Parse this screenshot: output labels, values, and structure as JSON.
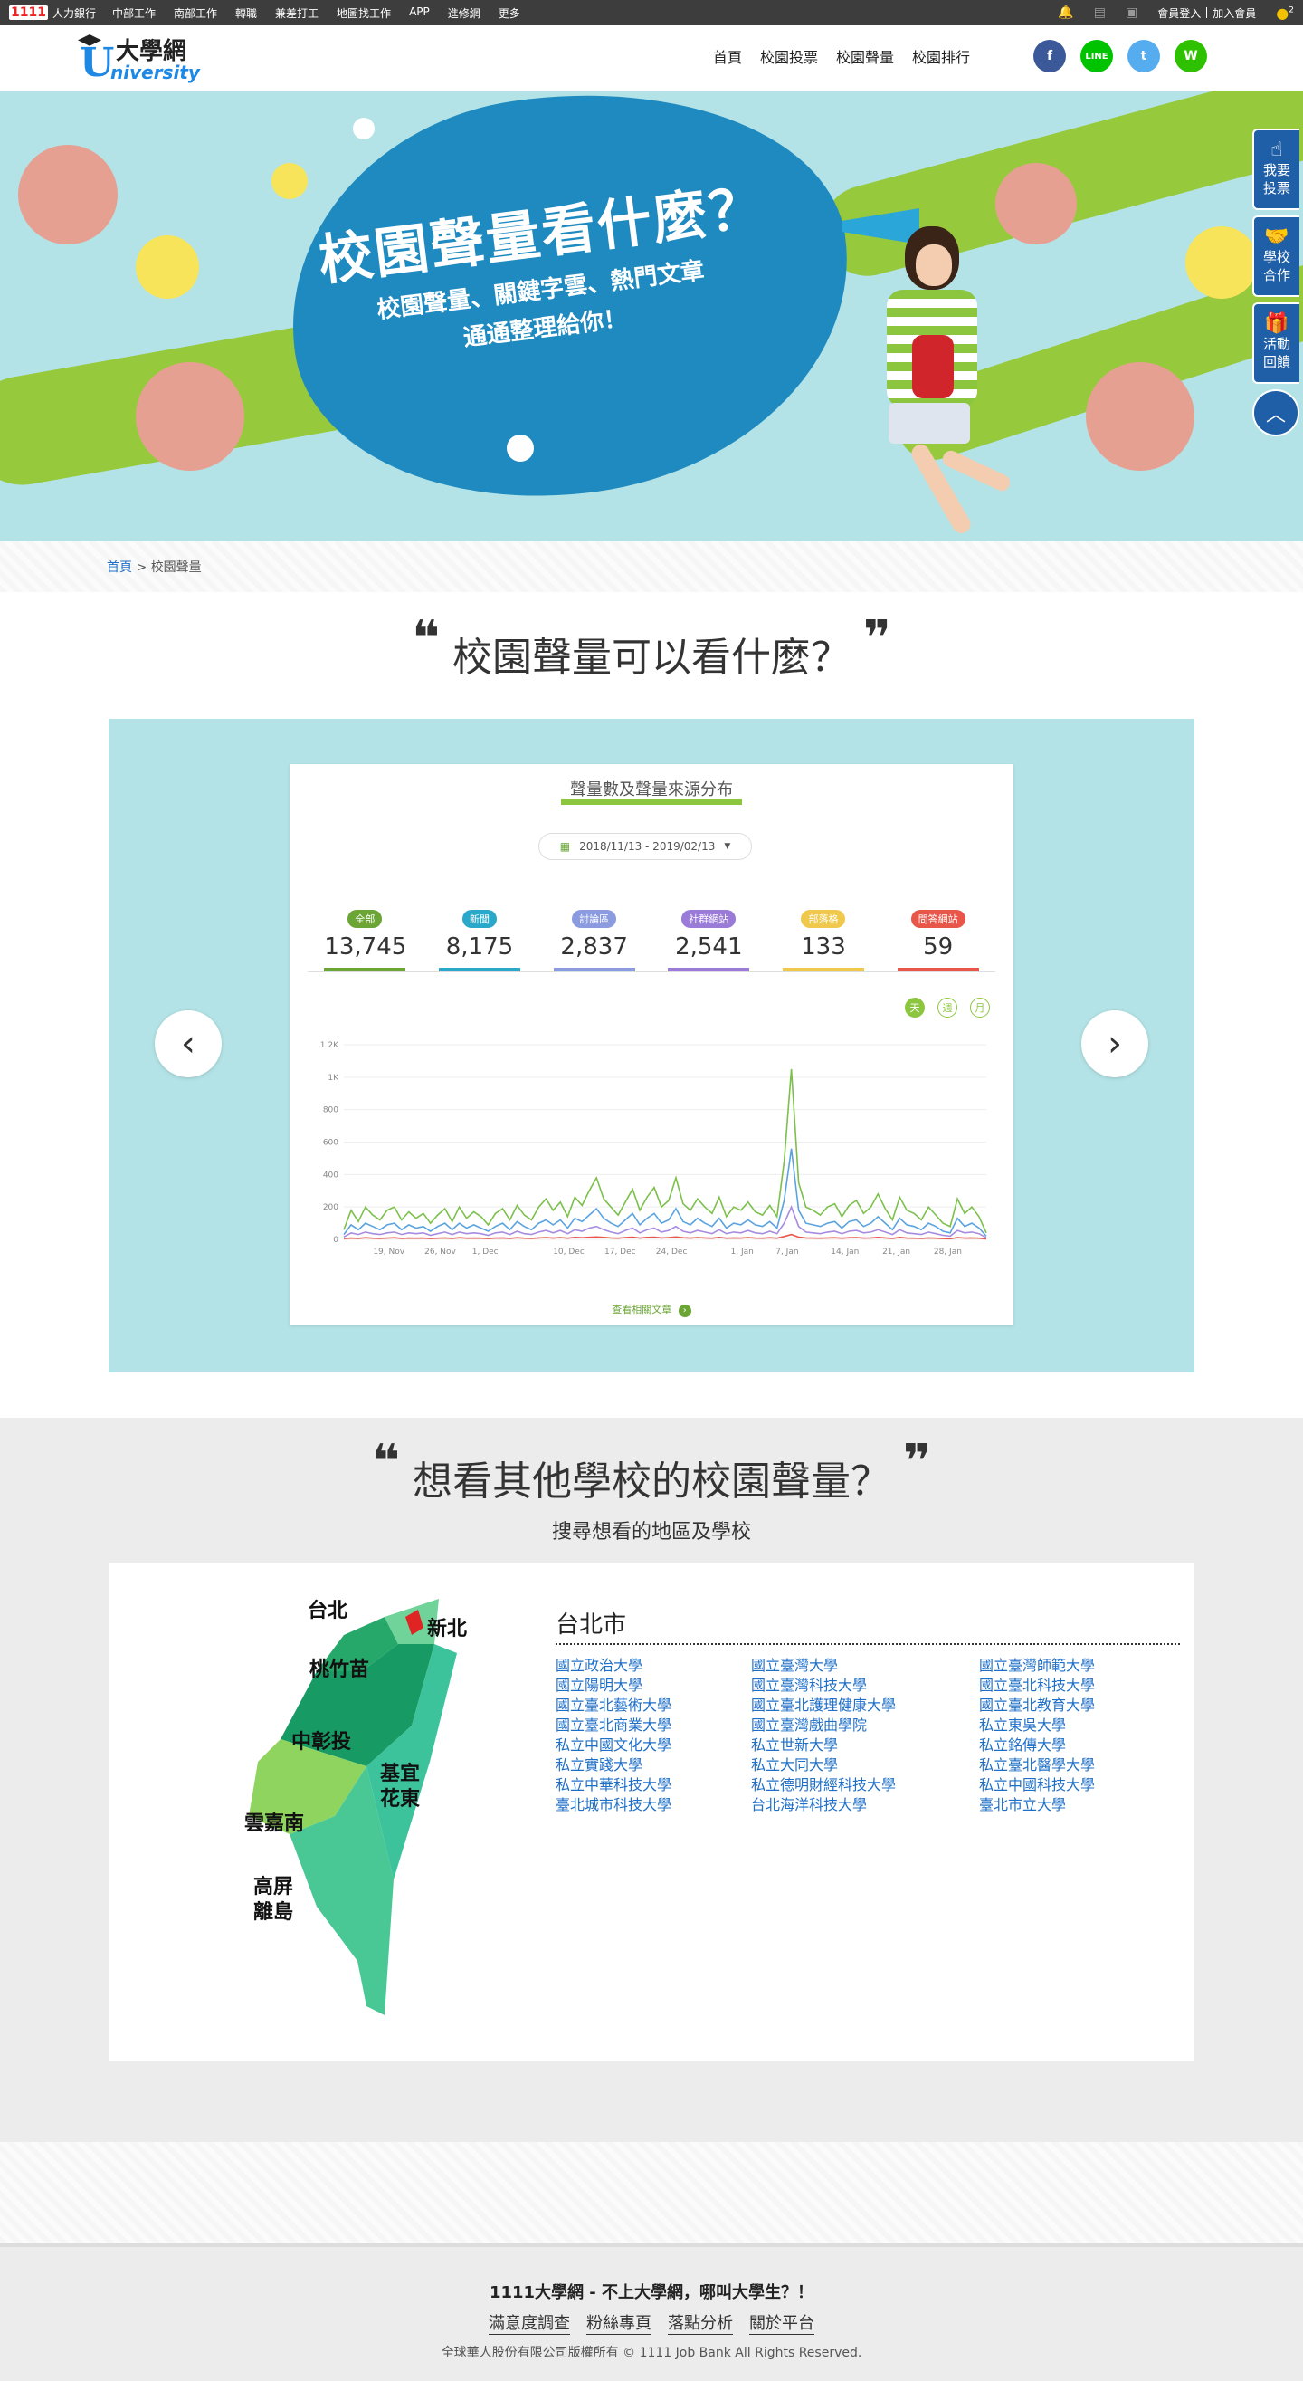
{
  "topbar": {
    "brand_num": "1111",
    "brand": "人力銀行",
    "links": [
      "中部工作",
      "南部工作",
      "轉職",
      "兼差打工",
      "地圖找工作",
      "APP",
      "進修網",
      "更多"
    ],
    "login": "會員登入",
    "register": "加入會員",
    "notify_count": "2"
  },
  "header": {
    "logo_cn": "大學網",
    "logo_u": "U",
    "logo_en": "niversity",
    "nav": [
      "首頁",
      "校園投票",
      "校園聲量",
      "校園排行"
    ],
    "social": [
      {
        "name": "facebook",
        "label": "f",
        "color": "#3b5998"
      },
      {
        "name": "line",
        "label": "LINE",
        "color": "#00c300"
      },
      {
        "name": "twitter",
        "label": "t",
        "color": "#55acee"
      },
      {
        "name": "wechat",
        "label": "W",
        "color": "#2dc100"
      }
    ]
  },
  "banner": {
    "title": "校園聲量看什麼？",
    "subtitle_line1": "校園聲量、關鍵字雲、熱門文章",
    "subtitle_line2": "通通整理給你！"
  },
  "side_buttons": [
    {
      "icon": "☝",
      "label1": "我要",
      "label2": "投票"
    },
    {
      "icon": "🤝",
      "label1": "學校",
      "label2": "合作"
    },
    {
      "icon": "🎁",
      "label1": "活動",
      "label2": "回饋"
    }
  ],
  "breadcrumb": {
    "home": "首頁",
    "sep": ">",
    "current": "校園聲量"
  },
  "section1": {
    "title": "校園聲量可以看什麼？",
    "quote_open": "❝",
    "quote_close": "❞",
    "card_title": "聲量數及聲量來源分布",
    "date_range": "2018/11/13 - 2019/02/13",
    "stats": [
      {
        "label": "全部",
        "value": "13,745",
        "color": "#6aa535"
      },
      {
        "label": "新聞",
        "value": "8,175",
        "color": "#29a8c9"
      },
      {
        "label": "討論區",
        "value": "2,837",
        "color": "#8a9be0"
      },
      {
        "label": "社群網站",
        "value": "2,541",
        "color": "#9a7bd8"
      },
      {
        "label": "部落格",
        "value": "133",
        "color": "#f0c94c"
      },
      {
        "label": "問答網站",
        "value": "59",
        "color": "#e8564a"
      }
    ],
    "toggles": [
      "天",
      "週",
      "月"
    ],
    "more_link": "查看相關文章",
    "prev_label": "‹",
    "next_label": "›"
  },
  "chart_data": {
    "type": "line",
    "title": "聲量數及聲量來源分布",
    "ylim": [
      0,
      1200
    ],
    "y_ticks": [
      "0",
      "200",
      "400",
      "600",
      "800",
      "1K",
      "1.2K"
    ],
    "x_ticks": [
      "19, Nov",
      "26, Nov",
      "1, Dec",
      "10, Dec",
      "17, Dec",
      "24, Dec",
      "1, Jan",
      "7, Jan",
      "14, Jan",
      "21, Jan",
      "28, Jan"
    ],
    "x_count": 90,
    "series": [
      {
        "name": "全部",
        "color": "#7cc04b",
        "values": [
          60,
          180,
          110,
          200,
          150,
          120,
          180,
          200,
          120,
          170,
          130,
          160,
          100,
          150,
          190,
          110,
          200,
          130,
          170,
          140,
          90,
          160,
          190,
          120,
          210,
          150,
          120,
          200,
          250,
          180,
          230,
          140,
          260,
          210,
          300,
          380,
          250,
          200,
          150,
          230,
          310,
          180,
          260,
          320,
          200,
          240,
          380,
          220,
          180,
          250,
          200,
          160,
          260,
          140,
          200,
          180,
          230,
          170,
          150,
          210,
          140,
          480,
          1050,
          350,
          200,
          180,
          150,
          200,
          220,
          140,
          210,
          240,
          160,
          200,
          280,
          190,
          120,
          260,
          180,
          160,
          120,
          200,
          150,
          100,
          80,
          250,
          160,
          200,
          140,
          40
        ]
      },
      {
        "name": "新聞",
        "color": "#5aa3e0",
        "values": [
          30,
          90,
          60,
          100,
          80,
          60,
          90,
          100,
          60,
          90,
          70,
          80,
          50,
          80,
          100,
          60,
          100,
          70,
          90,
          70,
          50,
          80,
          100,
          60,
          110,
          80,
          60,
          100,
          120,
          90,
          120,
          70,
          130,
          110,
          150,
          190,
          130,
          100,
          80,
          120,
          160,
          90,
          130,
          160,
          100,
          120,
          190,
          110,
          90,
          130,
          100,
          80,
          130,
          70,
          100,
          90,
          120,
          90,
          80,
          110,
          70,
          240,
          560,
          180,
          100,
          90,
          80,
          100,
          110,
          70,
          110,
          120,
          80,
          100,
          140,
          100,
          60,
          130,
          90,
          80,
          60,
          100,
          80,
          50,
          40,
          130,
          80,
          100,
          70,
          20
        ]
      },
      {
        "name": "討論區",
        "color": "#a68be0",
        "values": [
          15,
          40,
          30,
          45,
          35,
          30,
          40,
          45,
          30,
          40,
          35,
          40,
          25,
          35,
          45,
          30,
          45,
          35,
          40,
          35,
          25,
          40,
          45,
          30,
          50,
          35,
          30,
          45,
          55,
          40,
          55,
          35,
          60,
          50,
          70,
          80,
          60,
          45,
          35,
          55,
          70,
          40,
          60,
          70,
          45,
          55,
          80,
          50,
          40,
          55,
          45,
          35,
          60,
          35,
          45,
          40,
          55,
          40,
          35,
          50,
          35,
          100,
          200,
          80,
          45,
          40,
          35,
          45,
          50,
          35,
          50,
          55,
          40,
          45,
          60,
          45,
          30,
          60,
          40,
          35,
          30,
          45,
          35,
          25,
          20,
          55,
          40,
          45,
          35,
          10
        ]
      },
      {
        "name": "問答網站",
        "color": "#e8564a",
        "values": [
          5,
          8,
          6,
          10,
          7,
          6,
          8,
          10,
          6,
          8,
          7,
          8,
          5,
          7,
          9,
          6,
          10,
          7,
          8,
          7,
          5,
          8,
          9,
          6,
          10,
          7,
          6,
          9,
          11,
          8,
          11,
          7,
          12,
          10,
          13,
          15,
          12,
          9,
          7,
          11,
          14,
          8,
          12,
          14,
          9,
          11,
          15,
          10,
          8,
          11,
          9,
          7,
          12,
          7,
          9,
          8,
          11,
          8,
          7,
          10,
          7,
          18,
          30,
          14,
          9,
          8,
          7,
          9,
          10,
          7,
          10,
          11,
          8,
          9,
          12,
          9,
          6,
          12,
          8,
          7,
          6,
          9,
          7,
          5,
          4,
          11,
          8,
          9,
          7,
          3
        ]
      }
    ]
  },
  "section2": {
    "title": "想看其他學校的校園聲量？",
    "subtitle": "搜尋想看的地區及學校",
    "regions": [
      "台北",
      "新北",
      "桃竹苗",
      "中彰投",
      "基宜",
      "花東",
      "雲嘉南",
      "高屏",
      "離島"
    ],
    "city": "台北市",
    "schools": [
      "國立政治大學",
      "國立臺灣大學",
      "國立臺灣師範大學",
      "國立陽明大學",
      "國立臺灣科技大學",
      "國立臺北科技大學",
      "國立臺北藝術大學",
      "國立臺北護理健康大學",
      "國立臺北教育大學",
      "國立臺北商業大學",
      "國立臺灣戲曲學院",
      "私立東吳大學",
      "私立中國文化大學",
      "私立世新大學",
      "私立銘傳大學",
      "私立實踐大學",
      "私立大同大學",
      "私立臺北醫學大學",
      "私立中華科技大學",
      "私立德明財經科技大學",
      "私立中國科技大學",
      "臺北城市科技大學",
      "台北海洋科技大學",
      "臺北市立大學"
    ]
  },
  "footer": {
    "slogan": "1111大學網 - 不上大學網，哪叫大學生？！",
    "links": [
      "滿意度調查",
      "粉絲專頁",
      "落點分析",
      "關於平台"
    ],
    "copyright": "全球華人股份有限公司版權所有 © 1111 Job Bank All Rights Reserved."
  }
}
